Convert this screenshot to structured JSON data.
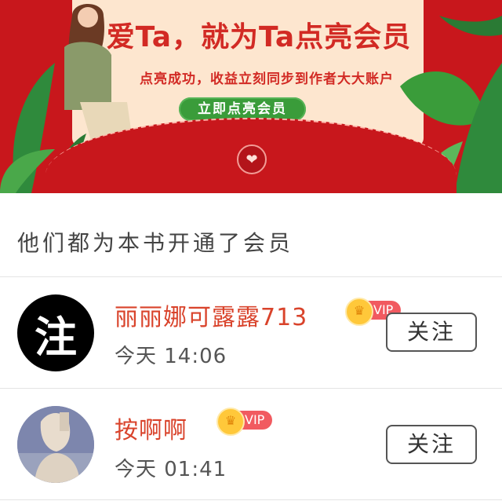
{
  "banner": {
    "title": "爱Ta，就为Ta点亮会员",
    "subtitle": "点亮成功，收益立刻同步到作者大大账户",
    "cta_label": "立即点亮会员",
    "seal_icon": "heart-seal-icon",
    "colors": {
      "background": "#c8171c",
      "card": "#fde6cf",
      "title": "#d22a24",
      "button": "#3a9c3a"
    }
  },
  "section": {
    "title": "他们都为本书开通了会员"
  },
  "members": [
    {
      "avatar_text": "注",
      "name": "丽丽娜可露露713",
      "badge": "VIP",
      "time": "今天 14:06",
      "follow_label": "关注"
    },
    {
      "avatar_text": "",
      "name": "按啊啊",
      "badge": "VIP",
      "time": "今天 01:41",
      "follow_label": "关注"
    }
  ]
}
